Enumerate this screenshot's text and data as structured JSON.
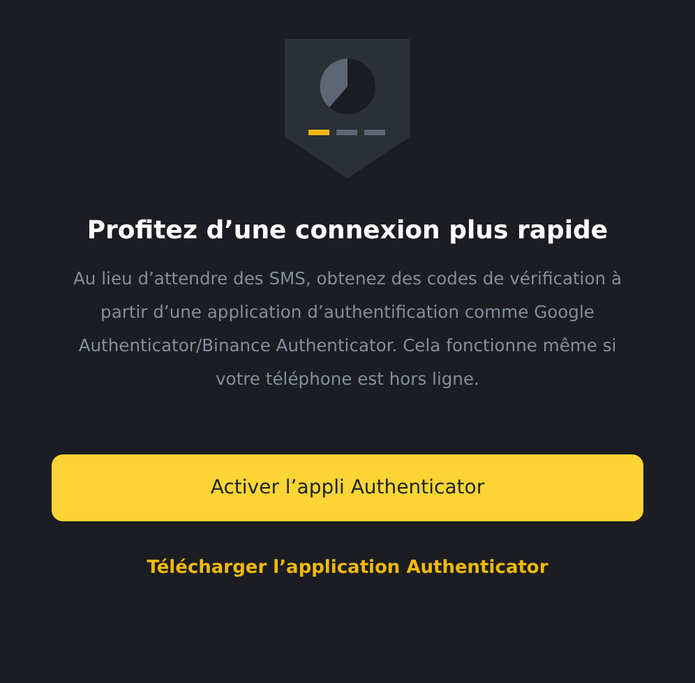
{
  "title": "Profitez d’une connexion plus rapide",
  "description": "Au lieu d’attendre des SMS, obtenez des codes de vérification à partir d’une application d’authentification comme Google Authenticator/Binance Authenticator. Cela fonctionne même si votre téléphone est hors ligne.",
  "primary_button": "Activer l’appli Authenticator",
  "download_link": "Télécharger l’application Authenticator"
}
